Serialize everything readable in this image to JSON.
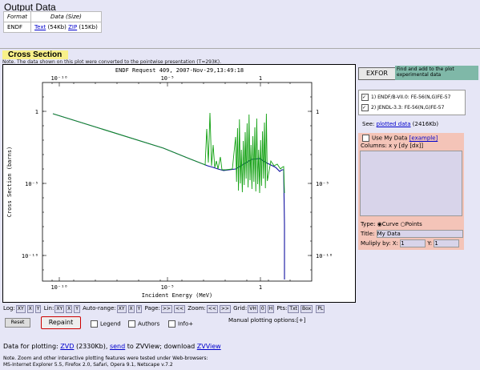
{
  "header": {
    "title": "Output Data"
  },
  "output_table": {
    "headers": [
      "Format",
      "Data (Size)"
    ],
    "row": {
      "format": "ENDF",
      "text_link": "Text",
      "text_size": "(54Kb)",
      "zip_link": "ZIP",
      "zip_size": "(15Kb)"
    }
  },
  "section": {
    "title": "Cross Section",
    "note": "Note. The data shown on this plot were converted to the pointwise presentation (T=293K)."
  },
  "chart_data": {
    "type": "line",
    "title": "ENDF Request 409, 2007-Nov-29,13:49:18",
    "xlabel": "Incident Energy (MeV)",
    "ylabel": "Cross Section (barns)",
    "x_ticks": [
      "10⁻¹⁰",
      "10⁻⁵",
      "1"
    ],
    "y_ticks": [
      "1",
      "10⁻⁵",
      "10⁻¹⁰"
    ],
    "xscale": "log",
    "yscale": "log",
    "series": [
      {
        "name": "ENDF/B-VII.0: FE-56(N,G)FE-57",
        "color": "#1010a0"
      },
      {
        "name": "JENDL-3.3: FE-56(N,G)FE-57",
        "color": "#10a010"
      }
    ]
  },
  "controls": {
    "row1": "Log: XY X Y  Lin: XY X Y  Auto-range: XY X Y  Page: >> <<  Zoom: << >>  Grid: VH 0 H  Pts: Txt Box  PL",
    "log": "Log:",
    "lin": "Lin:",
    "auto": "Auto-range:",
    "page": "Page:",
    "zoom": "Zoom:",
    "grid": "Grid:",
    "pts": "Pts:",
    "reset": "Reset",
    "repaint": "Repaint",
    "legend": "Legend",
    "authors": "Authors",
    "info": "Info+",
    "manual": "Manual plotting options:[+]"
  },
  "exfor": {
    "button": "EXFOR",
    "text": "Find and add to the plot experimental data"
  },
  "legend_items": [
    {
      "num": "1)",
      "label": "ENDF/B-VII.0: FE-56(N,G)FE-57"
    },
    {
      "num": "2)",
      "label": "JENDL-3.3: FE-56(N,G)FE-57"
    }
  ],
  "see": {
    "prefix": "See:",
    "link": "plotted data",
    "size": "(2416Kb)"
  },
  "mydata": {
    "use": "Use My Data",
    "example": "[example]",
    "columns": "Columns: x y [dy [dx]]",
    "type": "Type:",
    "curve": "Curve",
    "points": "Points",
    "title_label": "Title:",
    "title_value": "My Data",
    "multiply": "Muliply by:",
    "x": "X:",
    "x_val": "1",
    "y": "Y:",
    "y_val": "1"
  },
  "footer": {
    "data_prefix": "Data for plotting:",
    "zvd": "ZVD",
    "zvd_size": "(2330Kb),",
    "send": "send",
    "send_rest": "to ZVView; download",
    "zvview": "ZVView",
    "note1": "Note. Zoom and other interactive plotting features were tested under Web-browsers:",
    "note2": "MS-Internet Explorer 5.5, Firefox 2.0, Safari, Opera 9.1, Netscape v.7.2"
  }
}
